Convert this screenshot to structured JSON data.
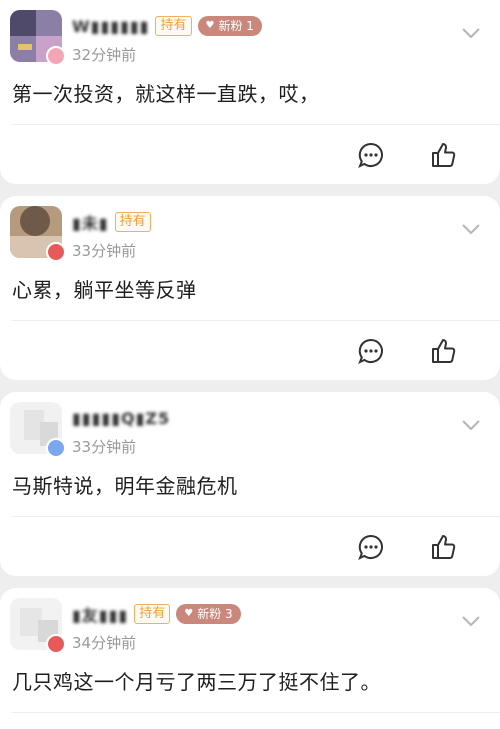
{
  "comments": [
    {
      "user_name": "W▮▮▮▮▮▮",
      "holding_badge": "持有",
      "fan_badge": "新粉 1",
      "time": "32分钟前",
      "text": "第一次投资，就这样一直跌，哎，",
      "avatar_colors": [
        "#8b7fa8",
        "#4f4a6a",
        "#c8a2c8"
      ],
      "badge_color": "#f3a6b5"
    },
    {
      "user_name": "▮未▮",
      "holding_badge": "持有",
      "fan_badge": "",
      "time": "33分钟前",
      "text": "心累，躺平坐等反弹",
      "avatar_colors": [
        "#b59a7e",
        "#6f5a4a",
        "#d8c4b0"
      ],
      "badge_color": "#e85a5a"
    },
    {
      "user_name": "▮▮▮▮▮Q▮Z5",
      "holding_badge": "",
      "fan_badge": "",
      "time": "33分钟前",
      "text": "马斯特说，明年金融危机",
      "avatar_colors": [
        "#f1f1f1",
        "#e4e4e4",
        "#d9d9d9"
      ],
      "badge_color": "#7aa7ee"
    },
    {
      "user_name": "▮友▮▮▮",
      "holding_badge": "持有",
      "fan_badge": "新粉 3",
      "time": "34分钟前",
      "text": "几只鸡这一个月亏了两三万了挺不住了。",
      "avatar_colors": [
        "#f2f2f2",
        "#e6e6e6",
        "#d8d8d8"
      ],
      "badge_color": "#e85a5a"
    }
  ],
  "icons": {
    "comment": "comment-icon",
    "like": "thumbs-up-icon",
    "expand": "chevron-down-icon"
  }
}
